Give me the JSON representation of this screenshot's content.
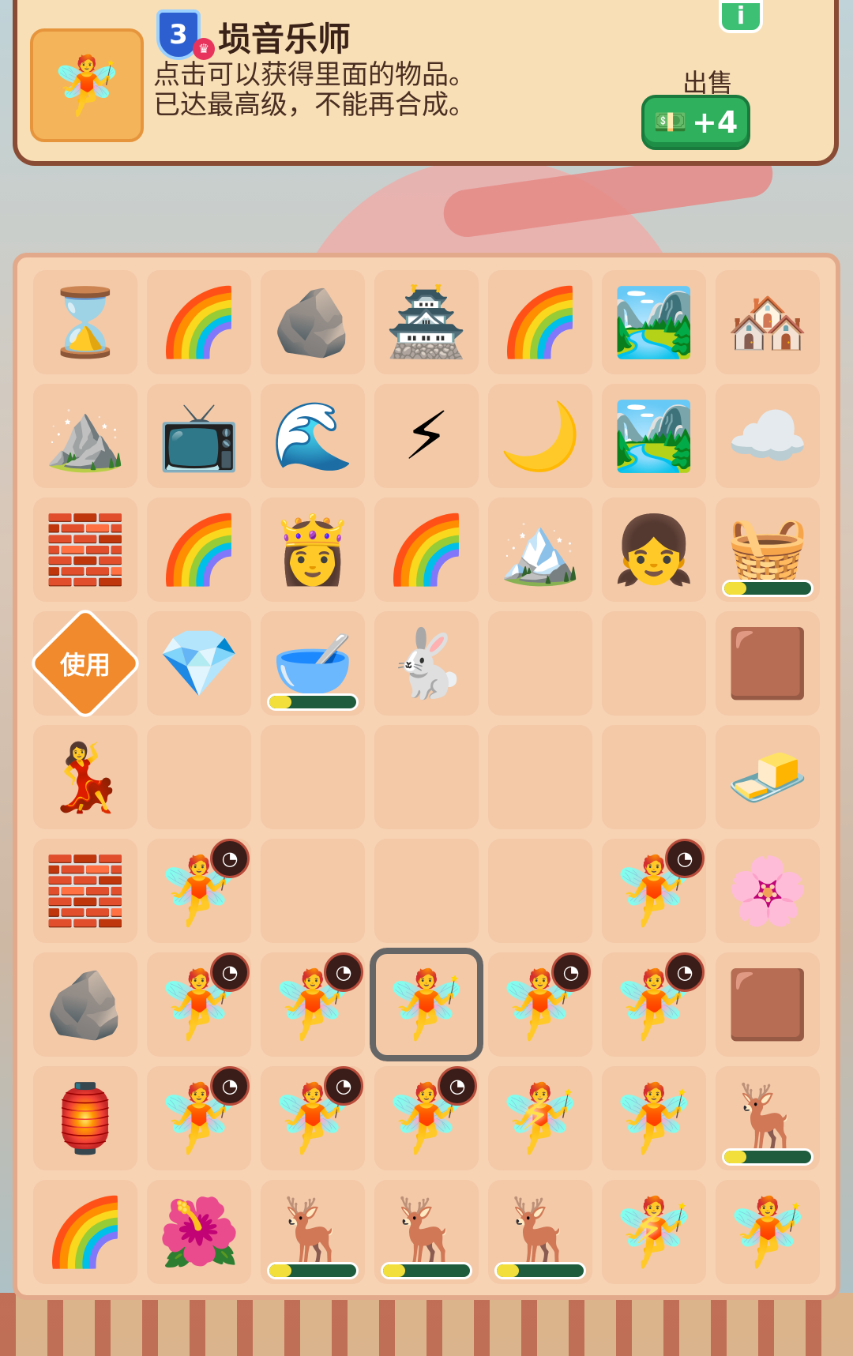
{
  "info": {
    "level": "3",
    "title": "埙音乐师",
    "desc_line1": "点击可以获得里面的物品。",
    "desc_line2": "已达最高级，不能再合成。",
    "sell_label": "出售",
    "sell_value": "+4",
    "info_button": "i",
    "thumb_icon": "musician-icon",
    "money_icon": "cash-icon"
  },
  "board": {
    "rows": 9,
    "cols": 7,
    "cells": [
      [
        {
          "icon": "hourglass-icon",
          "g": "⌛"
        },
        {
          "icon": "waterfall-rainbow-icon",
          "g": "🌈"
        },
        {
          "icon": "red-stone-icon",
          "g": "🪨"
        },
        {
          "icon": "pagoda-landscape-icon",
          "g": "🏯"
        },
        {
          "icon": "waterfall-rainbow-icon",
          "g": "🌈"
        },
        {
          "icon": "pagoda-lake-icon",
          "g": "🏞️"
        },
        {
          "icon": "village-lake-icon",
          "g": "🏘️"
        }
      ],
      [
        {
          "icon": "small-mountain-icon",
          "g": "⛰️"
        },
        {
          "icon": "retro-tv-icon",
          "g": "📺"
        },
        {
          "icon": "river-icon",
          "g": "🌊"
        },
        {
          "icon": "waterfall-energy-icon",
          "g": "⚡"
        },
        {
          "icon": "moon-pagoda-icon",
          "g": "🌙"
        },
        {
          "icon": "pagoda-lake-icon",
          "g": "🏞️"
        },
        {
          "icon": "cloud-icon",
          "g": "☁️"
        }
      ],
      [
        {
          "icon": "bricks-icon",
          "g": "🧱"
        },
        {
          "icon": "waterfall-rainbow-icon",
          "g": "🌈"
        },
        {
          "icon": "empress-icon",
          "g": "👸"
        },
        {
          "icon": "waterfall-rainbow-icon",
          "g": "🌈"
        },
        {
          "icon": "green-mountains-icon",
          "g": "🏔️"
        },
        {
          "icon": "girl-icon",
          "g": "👧"
        },
        {
          "icon": "cloud-basket-icon",
          "g": "🧺",
          "progress": 0.25
        }
      ],
      [
        {
          "icon": "use-tag",
          "use": "使用"
        },
        {
          "icon": "blue-ore-icon",
          "g": "💎"
        },
        {
          "icon": "mortar-icon",
          "g": "🥣",
          "progress": 0.25
        },
        {
          "icon": "rabbit-icon",
          "g": "🐇"
        },
        {
          "icon": "empty"
        },
        {
          "icon": "empty"
        },
        {
          "icon": "sand-pile-icon",
          "g": "🟫"
        }
      ],
      [
        {
          "icon": "lady-icon",
          "g": "💃"
        },
        {
          "icon": "empty"
        },
        {
          "icon": "empty"
        },
        {
          "icon": "empty"
        },
        {
          "icon": "empty"
        },
        {
          "icon": "empty"
        },
        {
          "icon": "tofu-icon",
          "g": "🧈"
        }
      ],
      [
        {
          "icon": "red-bricks-icon",
          "g": "🧱"
        },
        {
          "icon": "musician-icon",
          "g": "🧚",
          "timer": true
        },
        {
          "icon": "empty"
        },
        {
          "icon": "empty"
        },
        {
          "icon": "empty"
        },
        {
          "icon": "musician-icon",
          "g": "🧚",
          "timer": true
        },
        {
          "icon": "flower-icon",
          "g": "🌸"
        }
      ],
      [
        {
          "icon": "rock-pool-icon",
          "g": "🪨"
        },
        {
          "icon": "musician-icon",
          "g": "🧚",
          "timer": true
        },
        {
          "icon": "musician-icon",
          "g": "🧚",
          "timer": true
        },
        {
          "icon": "musician-icon",
          "g": "🧚",
          "selected": true
        },
        {
          "icon": "musician-icon",
          "g": "🧚",
          "timer": true
        },
        {
          "icon": "musician-icon",
          "g": "🧚",
          "timer": true
        },
        {
          "icon": "sand-pile-icon",
          "g": "🟫"
        }
      ],
      [
        {
          "icon": "lantern-icon",
          "g": "🏮"
        },
        {
          "icon": "musician-icon",
          "g": "🧚",
          "timer": true
        },
        {
          "icon": "musician-icon",
          "g": "🧚",
          "timer": true
        },
        {
          "icon": "musician-icon",
          "g": "🧚",
          "timer": true
        },
        {
          "icon": "musician-energy-icon",
          "g": "🧚",
          "bolt": true
        },
        {
          "icon": "musician-icon",
          "g": "🧚"
        },
        {
          "icon": "deer-icon",
          "g": "🦌",
          "progress": 0.25
        }
      ],
      [
        {
          "icon": "waterfall-rainbow-icon",
          "g": "🌈"
        },
        {
          "icon": "peony-icon",
          "g": "🌺"
        },
        {
          "icon": "deer-icon",
          "g": "🦌",
          "progress": 0.25
        },
        {
          "icon": "deer-icon",
          "g": "🦌",
          "progress": 0.25
        },
        {
          "icon": "deer-icon",
          "g": "🦌",
          "progress": 0.25
        },
        {
          "icon": "musician-energy-icon",
          "g": "🧚",
          "bolt": true
        },
        {
          "icon": "musician-icon",
          "g": "🧚"
        }
      ]
    ]
  }
}
